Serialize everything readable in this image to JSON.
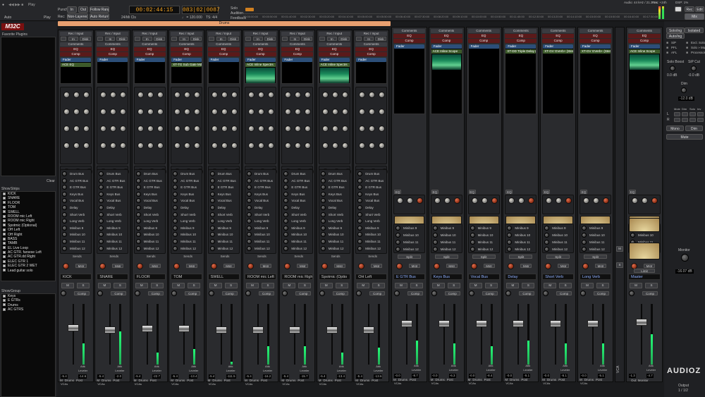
{
  "toolbar": {
    "auto_row_labels": [
      "Auto",
      "Play",
      "Punch:",
      "In",
      "Out",
      "Follow Range",
      "Rec:",
      "Non-Layered",
      "Auto Return"
    ],
    "sample_rate": "24/Mi Cls",
    "primary_clock": "00:02:44:15",
    "secondary_clock": "083|02|0087",
    "tempo": "♩ = 120.000",
    "meter": "TS: 4/4",
    "solo_labels": [
      "Solo",
      "Audition",
      "Feedback"
    ],
    "ruler": [
      "00:00:00:00",
      "00:00:50:00",
      "00:01:40:00",
      "00:02:30:00",
      "00:03:20:00",
      "00:04:10:00",
      "00:05:00:00",
      "00:05:50:00",
      "00:06:40:00",
      "00:07:30:00",
      "00:08:20:00",
      "00:09:10:00",
      "00:10:00:00",
      "00:10:50:00",
      "00:11:40:00",
      "00:12:30:00",
      "00:13:20:00",
      "00:14:10:00",
      "00:15:00:00",
      "00:15:50:00",
      "00:16:40:00",
      "00:17:30:00"
    ],
    "status": "Audio: 44 kHz / 21.3 ms",
    "status2": "Rec: +24h",
    "dsp": "DSP: 1%",
    "right_buttons": [
      "Rec",
      "Edit",
      "Mix"
    ]
  },
  "logo": "M32C",
  "favorite_plugins": "Favorite Plugins",
  "clear": "Clear",
  "strips_header": {
    "show": "Show",
    "name": "Strips"
  },
  "strip_list": [
    "KICK",
    "SNARE",
    "FLOOR",
    "TOM",
    "SWELL",
    "ROOM mic Left",
    "ROOM mic Right",
    "Spotmic (Optional)",
    "OH Left",
    "OH Right",
    "BASS",
    "TAMB",
    "EL Live Loop",
    "AC GTR. farsese Left",
    "AC GTR.dd Right",
    "ELEC GTR 1",
    "ELEC GTR 2 WET",
    "Lead guitar solo"
  ],
  "groups_header": {
    "show": "Show",
    "name": "Group"
  },
  "group_list": [
    "Keys",
    "E GTRs",
    "Drums",
    "AC GTRS"
  ],
  "group_tab": "Drums",
  "strip_common": {
    "rec_input": "Rec / Input",
    "in": "In",
    "disk": "Disk",
    "comments": "Comments",
    "eq": "EQ",
    "comp": "Comp",
    "fader": "Fader",
    "sends": [
      "Drum Bus",
      "AC GTR Bus",
      "E GTR Bus",
      "Keys Bus",
      "Vocal Bus",
      "Delay",
      "Short Verb",
      "Long Verb",
      "Minibus 9",
      "Minibus 10",
      "Minibus 11",
      "Minibus 12"
    ],
    "send_label": "Sends",
    "eq_label": "EQ",
    "split": "Split",
    "mstr": "Mstr",
    "m": "M",
    "s": "S",
    "comp_btn": "Comp",
    "ratio": "Ratio",
    "attk": "Attk",
    "leveler": "Leveler",
    "compr": "Compr",
    "bottom": [
      "M",
      "Drums",
      "Post"
    ],
    "vca": "VCAs"
  },
  "channels": [
    {
      "name": "KICK",
      "plugin": "ACE EQ",
      "gain": "-5.4",
      "peak": "-14.6",
      "fader": 0.62,
      "meter": 0.35
    },
    {
      "name": "SNARE",
      "plugin": "",
      "gain": "-5.4",
      "peak": "-2.0",
      "fader": 0.58,
      "meter": 0.55
    },
    {
      "name": "FLOOR",
      "plugin": "",
      "gain": "-5.4",
      "peak": "-22.7",
      "fader": 0.6,
      "meter": 0.2
    },
    {
      "name": "TOM",
      "plugin": "XT-TG Sub Gate Mdn",
      "gain": "-5.4",
      "peak": "-13.4",
      "fader": 0.6,
      "meter": 0.25
    },
    {
      "name": "SWELL",
      "plugin": "",
      "gain": "-5.4",
      "peak": "-111.5",
      "fader": 0.58,
      "meter": 0.05
    },
    {
      "name": "ROOM mic Left",
      "plugin": "ACE Inline Spectrs",
      "gain": "-5.4",
      "peak": "-16.2",
      "fader": 0.58,
      "meter": 0.3
    },
    {
      "name": "ROOM mic Righ",
      "plugin": "",
      "gain": "-5.4",
      "peak": "-15.7",
      "fader": 0.58,
      "meter": 0.3
    },
    {
      "name": "Spotmic (Optio",
      "plugin": "ACE Inline Spectrs",
      "gain": "-5.4",
      "peak": "-13.4",
      "fader": 0.58,
      "meter": 0.2
    },
    {
      "name": "OH Left",
      "plugin": "",
      "gain": "-5.4",
      "peak": "-13.6",
      "fader": 0.58,
      "meter": 0.28
    }
  ],
  "buses": [
    {
      "name": "E GTR Bus",
      "plugin": "",
      "gain": "-0.0",
      "peak": "-8.7",
      "fader": 0.7,
      "meter": 0.4
    },
    {
      "name": "Keys Bus",
      "plugin": "ACE Inline Scope",
      "gain": "-0.0",
      "peak": "-6.3",
      "fader": 0.7,
      "meter": 0.35
    },
    {
      "name": "Vocal Bus",
      "plugin": "",
      "gain": "-0.0",
      "peak": "-8.4",
      "fader": 0.7,
      "meter": 0.3
    },
    {
      "name": "Delay",
      "plugin": "XT-DD Triple Delay (St)",
      "gain": "-0.0",
      "peak": "-5.1",
      "fader": 0.7,
      "meter": 0.4
    },
    {
      "name": "Short Verb",
      "plugin": "XT-GV GVerb+ (Stereo)",
      "gain": "-0.0",
      "peak": "-5.1",
      "fader": 0.7,
      "meter": 0.35
    },
    {
      "name": "Long Verb",
      "plugin": "XT-GV GVerb+ (Stereo)",
      "gain": "-0.0",
      "peak": "-5.1",
      "fader": 0.7,
      "meter": 0.35
    }
  ],
  "master": {
    "name": "Master",
    "plugin": "ACE Inline Scope",
    "gain": "-1.3",
    "peak": "-4.7",
    "limit": "Limit",
    "out": "Out: Monitor",
    "fader": 0.72,
    "meter": 0.5
  },
  "vca_label": "VCA",
  "right_panel": {
    "tabs": [
      "Solo/ing",
      "Isolated",
      "Auto/ing"
    ],
    "opts": [
      "SiP",
      "Excl. Solo",
      "PFL",
      "Solo » Mute",
      "AFL",
      "Processors"
    ],
    "solo_boost": "Solo Boost",
    "sip_cut": "SiP Cut",
    "solo_boost_val": "0.0 dB",
    "sip_cut_val": "-0.0 dB",
    "dim": "Dim",
    "dim_val": "-12.0 dB",
    "mono_labels": [
      "Mute",
      "Dim",
      "Solo",
      "Inv"
    ],
    "mono": "Mono",
    "dim_btn": "Dim",
    "mute": "Mute",
    "monitor": "Monitor",
    "monitor_val": "-16.07 dB",
    "output": "Output",
    "output_val": "1 / 1/2"
  },
  "watermark": "AUDIOZ"
}
